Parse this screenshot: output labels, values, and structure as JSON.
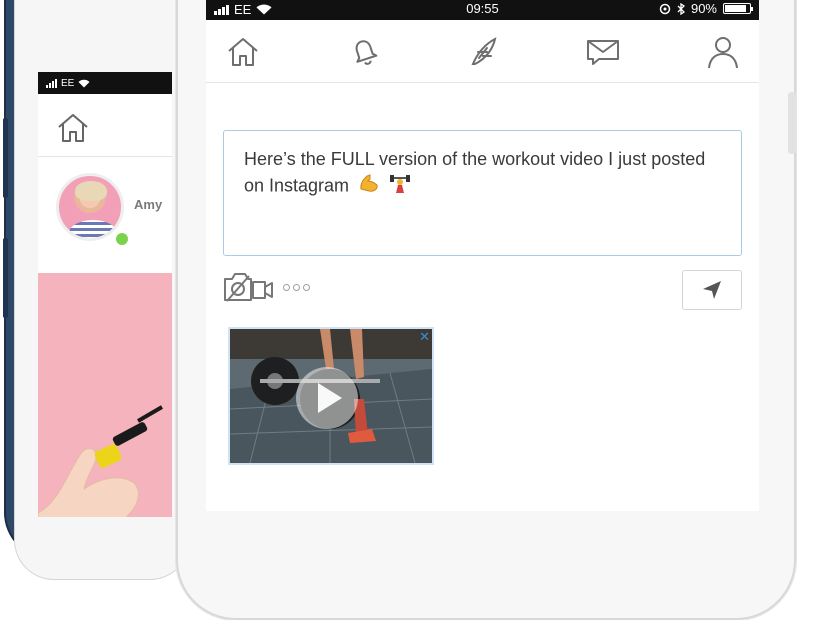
{
  "left_phone": {
    "status": {
      "carrier": "EE"
    },
    "profile": {
      "name": "Amy",
      "online_color": "#7cd34b"
    },
    "accent_panel_color": "#f4b3bd"
  },
  "main_phone": {
    "status": {
      "carrier": "EE",
      "time": "09:55",
      "battery": "90%"
    },
    "nav": {
      "items": [
        {
          "icon": "home-icon"
        },
        {
          "icon": "bell-icon"
        },
        {
          "icon": "quill-icon"
        },
        {
          "icon": "envelope-icon"
        },
        {
          "icon": "user-icon"
        }
      ]
    },
    "composer": {
      "text": "Here’s the FULL version of the workout video I just posted on Instagram",
      "emojis": [
        "💪",
        "🏋"
      ],
      "border_color": "#a9cbe6"
    },
    "toolbar": {
      "camera_icon": "camera-video-icon",
      "more_icon": "more-dots-icon",
      "send_icon": "send-arrow-icon"
    },
    "attachment": {
      "type": "video",
      "close_label": "✕"
    }
  }
}
